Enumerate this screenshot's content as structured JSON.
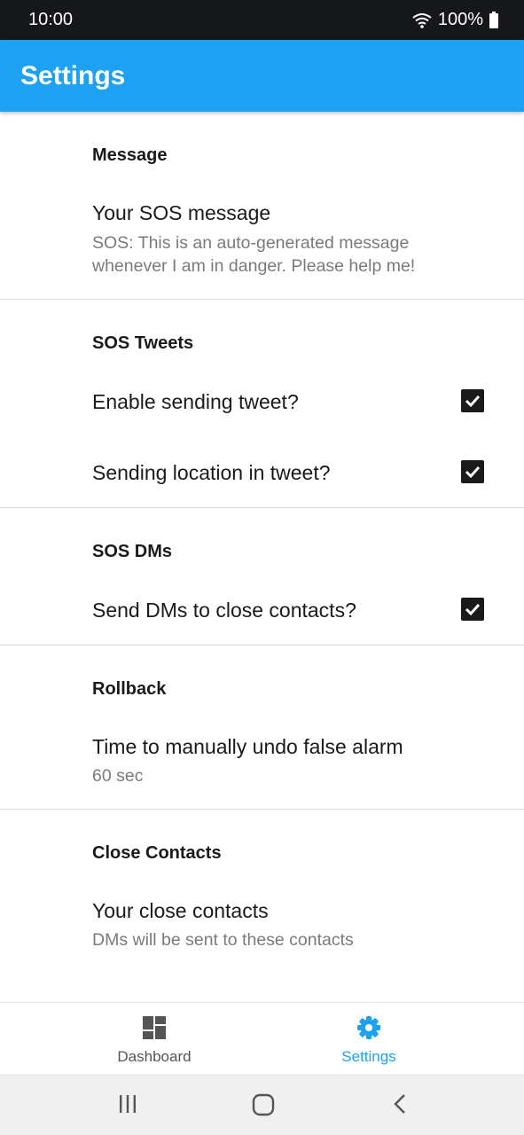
{
  "status_bar": {
    "time": "10:00",
    "battery": "100%"
  },
  "app_bar": {
    "title": "Settings"
  },
  "sections": {
    "message": {
      "header": "Message",
      "sos_message_title": "Your SOS message",
      "sos_message_summary": "SOS: This is an auto-generated message whenever I am in danger. Please help me!"
    },
    "tweets": {
      "header": "SOS Tweets",
      "enable_tweet_title": "Enable sending tweet?",
      "enable_tweet_checked": true,
      "location_tweet_title": "Sending location in tweet?",
      "location_tweet_checked": true
    },
    "dms": {
      "header": "SOS DMs",
      "send_dms_title": "Send DMs to close contacts?",
      "send_dms_checked": true
    },
    "rollback": {
      "header": "Rollback",
      "undo_title": "Time to manually undo false alarm",
      "undo_summary": "60 sec"
    },
    "contacts": {
      "header": "Close Contacts",
      "contacts_title": "Your close contacts",
      "contacts_summary": "DMs will be sent to these contacts"
    }
  },
  "bottom_nav": {
    "dashboard_label": "Dashboard",
    "settings_label": "Settings",
    "active": "settings",
    "active_color": "#1da1f2",
    "inactive_color": "#555555"
  },
  "icons": {
    "wifi": "wifi-icon",
    "battery": "battery-icon",
    "dashboard": "dashboard-icon",
    "settings": "gear-icon",
    "recents": "recents-icon",
    "home": "home-icon",
    "back": "back-icon"
  }
}
